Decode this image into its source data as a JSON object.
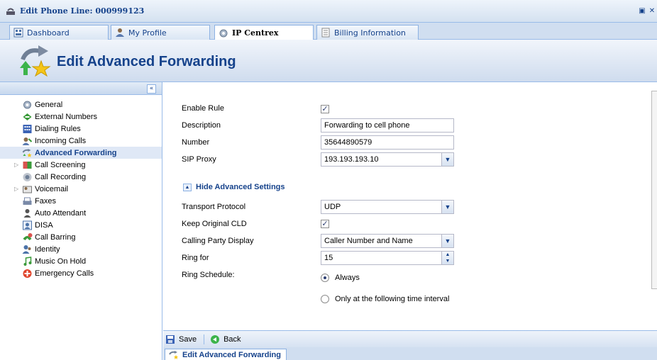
{
  "window": {
    "title": "Edit Phone Line: 000999123"
  },
  "tabs": [
    {
      "label": "Dashboard"
    },
    {
      "label": "My Profile"
    },
    {
      "label": "IP Centrex"
    },
    {
      "label": "Billing Information"
    }
  ],
  "header": {
    "title": "Edit Advanced Forwarding"
  },
  "sidebar": {
    "items": [
      {
        "label": "General"
      },
      {
        "label": "External Numbers"
      },
      {
        "label": "Dialing Rules"
      },
      {
        "label": "Incoming Calls"
      },
      {
        "label": "Advanced Forwarding"
      },
      {
        "label": "Call Screening"
      },
      {
        "label": "Call Recording"
      },
      {
        "label": "Voicemail"
      },
      {
        "label": "Faxes"
      },
      {
        "label": "Auto Attendant"
      },
      {
        "label": "DISA"
      },
      {
        "label": "Call Barring"
      },
      {
        "label": "Identity"
      },
      {
        "label": "Music On Hold"
      },
      {
        "label": "Emergency Calls"
      }
    ]
  },
  "form": {
    "enable_rule": {
      "label": "Enable Rule",
      "checked": true
    },
    "description": {
      "label": "Description",
      "value": "Forwarding to cell phone"
    },
    "number": {
      "label": "Number",
      "value": "35644890579"
    },
    "sip_proxy": {
      "label": "SIP Proxy",
      "value": "193.193.193.10"
    },
    "advanced_toggle": "Hide Advanced Settings",
    "transport_protocol": {
      "label": "Transport Protocol",
      "value": "UDP"
    },
    "keep_original_cld": {
      "label": "Keep Original CLD",
      "checked": true
    },
    "calling_party_display": {
      "label": "Calling Party Display",
      "value": "Caller Number and Name"
    },
    "ring_for": {
      "label": "Ring for",
      "value": "15"
    },
    "ring_schedule": {
      "label": "Ring Schedule:",
      "options": [
        "Always",
        "Only at the following time interval"
      ],
      "selected": "Always"
    }
  },
  "toolbar": {
    "save_label": "Save",
    "back_label": "Back"
  },
  "bottom_tab": {
    "label": "Edit Advanced Forwarding"
  }
}
